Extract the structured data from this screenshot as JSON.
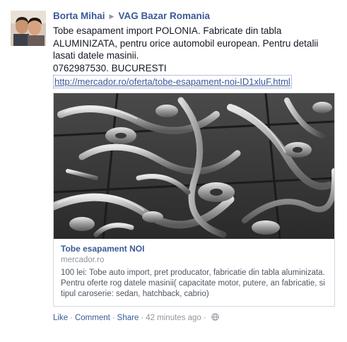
{
  "post": {
    "author": "Borta Mihai",
    "group": "VAG Bazar Romania",
    "message_lines": [
      "Tobe esapament import POLONIA. Fabricate din tabla",
      "ALUMINIZATA, pentru orice automobil european. Pentru detalii",
      "lasati datele masinii.",
      "0762987530. BUCURESTI"
    ],
    "url": "http://mercador.ro/oferta/tobe-esapament-noi-ID1xluF.html",
    "attachment": {
      "title": "Tobe esapament NOI",
      "domain": "mercador.ro",
      "description": "100 lei: Tobe auto import, pret producator, fabricatie din tabla aluminizata. Pentru oferte rog datele masinii( capacitate motor, putere, an fabricatie, si tipul caroserie: sedan, hatchback, cabrio)"
    },
    "actions": {
      "like": "Like",
      "comment": "Comment",
      "share": "Share",
      "separator": "·",
      "timestamp": "42 minutes ago"
    },
    "icons": {
      "arrow": "triangle-right-icon",
      "privacy": "globe-icon"
    },
    "colors": {
      "link": "#3b5998",
      "meta": "#90949c"
    }
  }
}
